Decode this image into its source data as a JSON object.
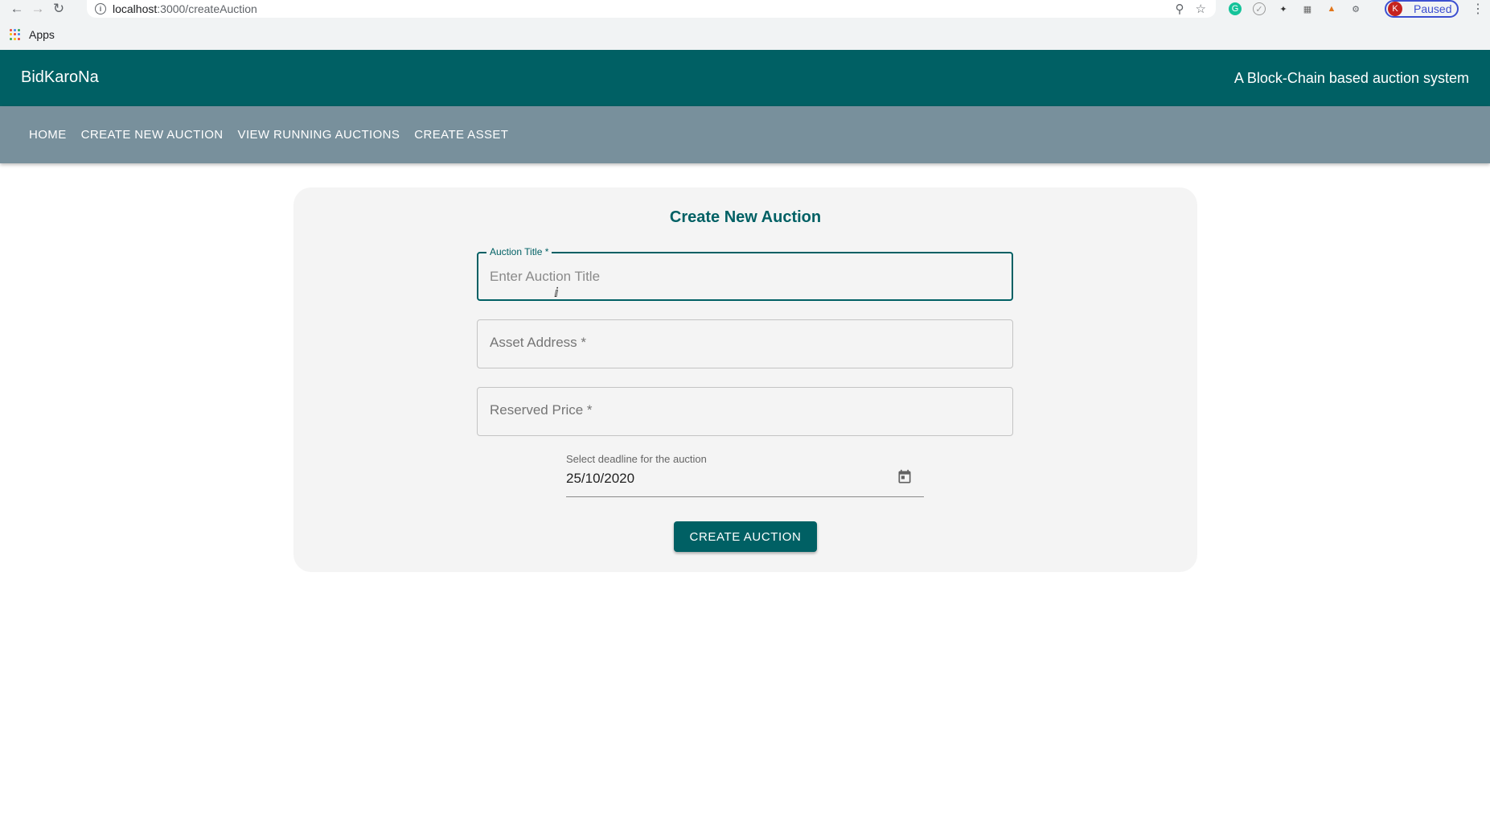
{
  "browser": {
    "url_host": "localhost",
    "url_path": ":3000/createAuction",
    "profile_initial": "K",
    "profile_status": "Paused",
    "bookmark_apps": "Apps"
  },
  "header": {
    "brand": "BidKaroNa",
    "tagline": "A Block-Chain based auction system"
  },
  "nav": {
    "items": [
      "HOME",
      "CREATE NEW AUCTION",
      "VIEW RUNNING AUCTIONS",
      "CREATE ASSET"
    ]
  },
  "form": {
    "title": "Create New Auction",
    "auction_title_label": "Auction Title *",
    "auction_title_placeholder": "Enter Auction Title",
    "asset_address_label": "Asset Address *",
    "reserved_price_label": "Reserved Price *",
    "deadline_label": "Select deadline for the auction",
    "deadline_value": "25/10/2020",
    "submit_label": "CREATE AUCTION"
  },
  "colors": {
    "header_bg": "#006064",
    "nav_bg": "#78909c",
    "accent": "#006064"
  }
}
